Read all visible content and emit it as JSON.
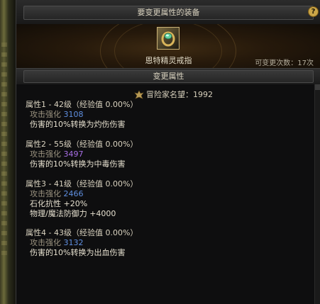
{
  "window": {
    "title": "要变更属性的装备",
    "help_label": "?"
  },
  "item": {
    "name": "恩特精灵戒指",
    "remaining_label": "可变更次数：17次",
    "icon": "ring-icon"
  },
  "section": {
    "title": "变更属性"
  },
  "fame": {
    "label": "冒险家名望：1992",
    "icon": "fame-crest-icon"
  },
  "properties": [
    {
      "header": "属性1 - 42级（经验值 0.00%）",
      "stat_label": "攻击强化",
      "stat_value": "3108",
      "stat_color": "blue",
      "lines": [
        "伤害的10%转换为灼伤伤害"
      ]
    },
    {
      "header": "属性2 - 55级（经验值 0.00%）",
      "stat_label": "攻击强化",
      "stat_value": "3497",
      "stat_color": "purple",
      "lines": [
        "伤害的10%转换为中毒伤害"
      ]
    },
    {
      "header": "属性3 - 41级（经验值 0.00%）",
      "stat_label": "攻击强化",
      "stat_value": "2466",
      "stat_color": "blue",
      "lines": [
        "石化抗性 +20%",
        "物理/魔法防御力 +4000"
      ]
    },
    {
      "header": "属性4 - 43级（经验值 0.00%）",
      "stat_label": "攻击强化",
      "stat_value": "3132",
      "stat_color": "blue",
      "lines": [
        "伤害的10%转换为出血伤害"
      ]
    }
  ],
  "colors": {
    "value_blue": "#5f8fe0",
    "value_purple": "#a86ee6",
    "help_gold": "#caa548"
  }
}
